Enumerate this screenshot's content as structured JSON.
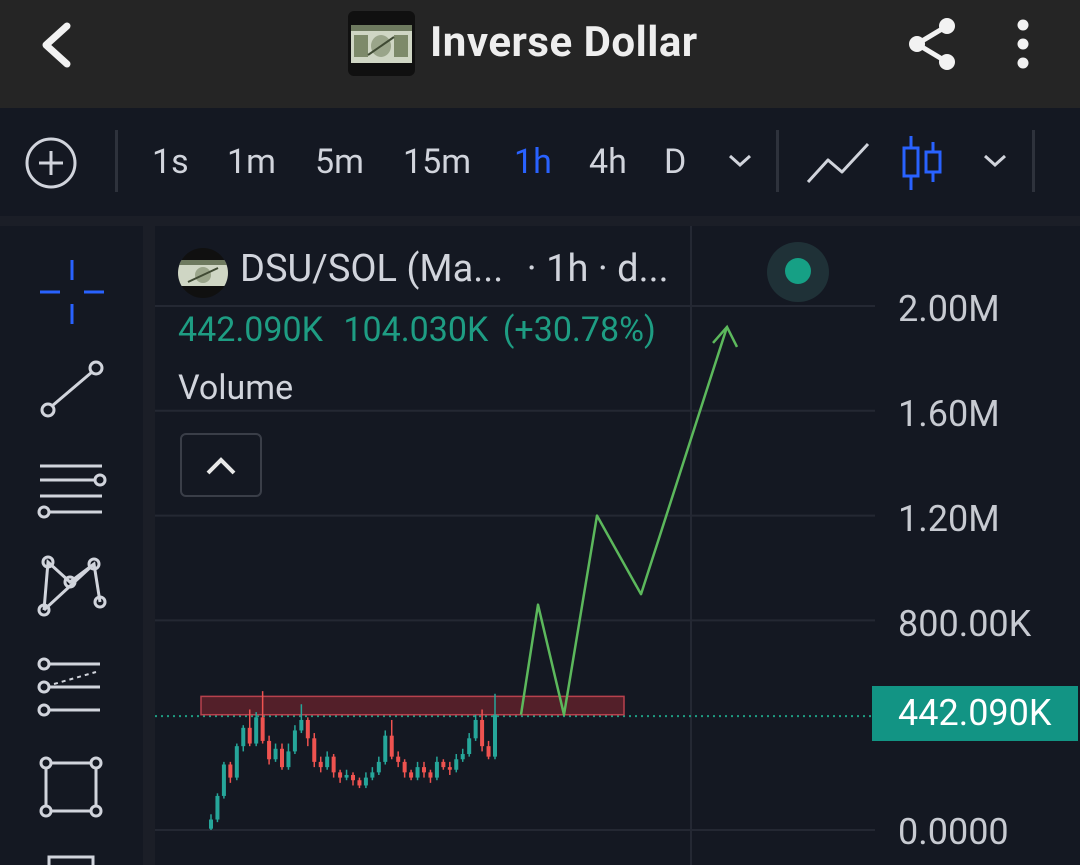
{
  "header": {
    "title": "Inverse Dollar",
    "icons": [
      "back-arrow-icon",
      "token-logo",
      "share-icon",
      "more-vertical-icon"
    ]
  },
  "toolbar": {
    "intervals": [
      "1s",
      "1m",
      "5m",
      "15m",
      "1h",
      "4h",
      "D"
    ],
    "active_interval": "1h",
    "accent": "#2962ff",
    "icons": [
      "add-circle-icon",
      "chevron-down-icon",
      "line-chart-icon",
      "candlestick-icon",
      "chevron-down-icon"
    ]
  },
  "drawing_tools": [
    "crosshair-icon",
    "trend-line-icon",
    "horizontal-lines-icon",
    "pattern-icon",
    "fib-tool-icon",
    "rectangle-icon"
  ],
  "chart": {
    "pair": "DSU/SOL (Ma...",
    "meta": "· 1h · d...",
    "last_price": "442.090K",
    "change_abs": "104.030K",
    "change_pct": "(+30.78%)",
    "volume_label": "Volume",
    "up_color": "#26a69a",
    "down_color": "#ef5350",
    "annotation_color": "#5cb85c",
    "price_axis": [
      "2.00M",
      "1.60M",
      "1.20M",
      "800.00K",
      "0.0000"
    ],
    "current_price_label": "442.090K"
  },
  "chart_data": {
    "type": "candlestick",
    "title": "DSU/SOL",
    "interval": "1h",
    "y_ticks": [
      0,
      800000,
      1200000,
      1600000,
      2000000
    ],
    "last_close": 442090,
    "resistance_zone": [
      440000,
      510000
    ],
    "projection_path": [
      440000,
      860000,
      440000,
      1200000,
      900000,
      1920000
    ],
    "candles_ohlc": [
      [
        5000,
        40000,
        0,
        60000
      ],
      [
        40000,
        130000,
        30000,
        140000
      ],
      [
        130000,
        250000,
        120000,
        260000
      ],
      [
        250000,
        200000,
        180000,
        260000
      ],
      [
        200000,
        320000,
        190000,
        330000
      ],
      [
        320000,
        390000,
        300000,
        400000
      ],
      [
        390000,
        330000,
        320000,
        460000
      ],
      [
        330000,
        430000,
        320000,
        450000
      ],
      [
        430000,
        340000,
        330000,
        530000
      ],
      [
        340000,
        270000,
        250000,
        360000
      ],
      [
        270000,
        310000,
        260000,
        330000
      ],
      [
        310000,
        240000,
        230000,
        330000
      ],
      [
        240000,
        300000,
        230000,
        330000
      ],
      [
        300000,
        380000,
        290000,
        400000
      ],
      [
        380000,
        420000,
        370000,
        480000
      ],
      [
        420000,
        350000,
        320000,
        430000
      ],
      [
        350000,
        260000,
        240000,
        370000
      ],
      [
        260000,
        240000,
        220000,
        280000
      ],
      [
        240000,
        280000,
        230000,
        300000
      ],
      [
        280000,
        220000,
        200000,
        290000
      ],
      [
        220000,
        200000,
        180000,
        230000
      ],
      [
        200000,
        210000,
        190000,
        230000
      ],
      [
        210000,
        190000,
        170000,
        220000
      ],
      [
        190000,
        170000,
        160000,
        200000
      ],
      [
        170000,
        200000,
        160000,
        220000
      ],
      [
        200000,
        220000,
        190000,
        240000
      ],
      [
        220000,
        260000,
        210000,
        280000
      ],
      [
        260000,
        360000,
        250000,
        380000
      ],
      [
        360000,
        280000,
        270000,
        420000
      ],
      [
        280000,
        260000,
        240000,
        300000
      ],
      [
        260000,
        220000,
        200000,
        270000
      ],
      [
        220000,
        200000,
        190000,
        230000
      ],
      [
        200000,
        240000,
        190000,
        260000
      ],
      [
        240000,
        220000,
        200000,
        260000
      ],
      [
        220000,
        200000,
        180000,
        230000
      ],
      [
        200000,
        260000,
        190000,
        280000
      ],
      [
        260000,
        240000,
        230000,
        270000
      ],
      [
        240000,
        230000,
        210000,
        260000
      ],
      [
        230000,
        270000,
        220000,
        290000
      ],
      [
        270000,
        290000,
        260000,
        310000
      ],
      [
        290000,
        350000,
        280000,
        370000
      ],
      [
        350000,
        420000,
        340000,
        440000
      ],
      [
        420000,
        320000,
        300000,
        460000
      ],
      [
        320000,
        280000,
        270000,
        340000
      ],
      [
        280000,
        440000,
        270000,
        520000
      ]
    ]
  }
}
